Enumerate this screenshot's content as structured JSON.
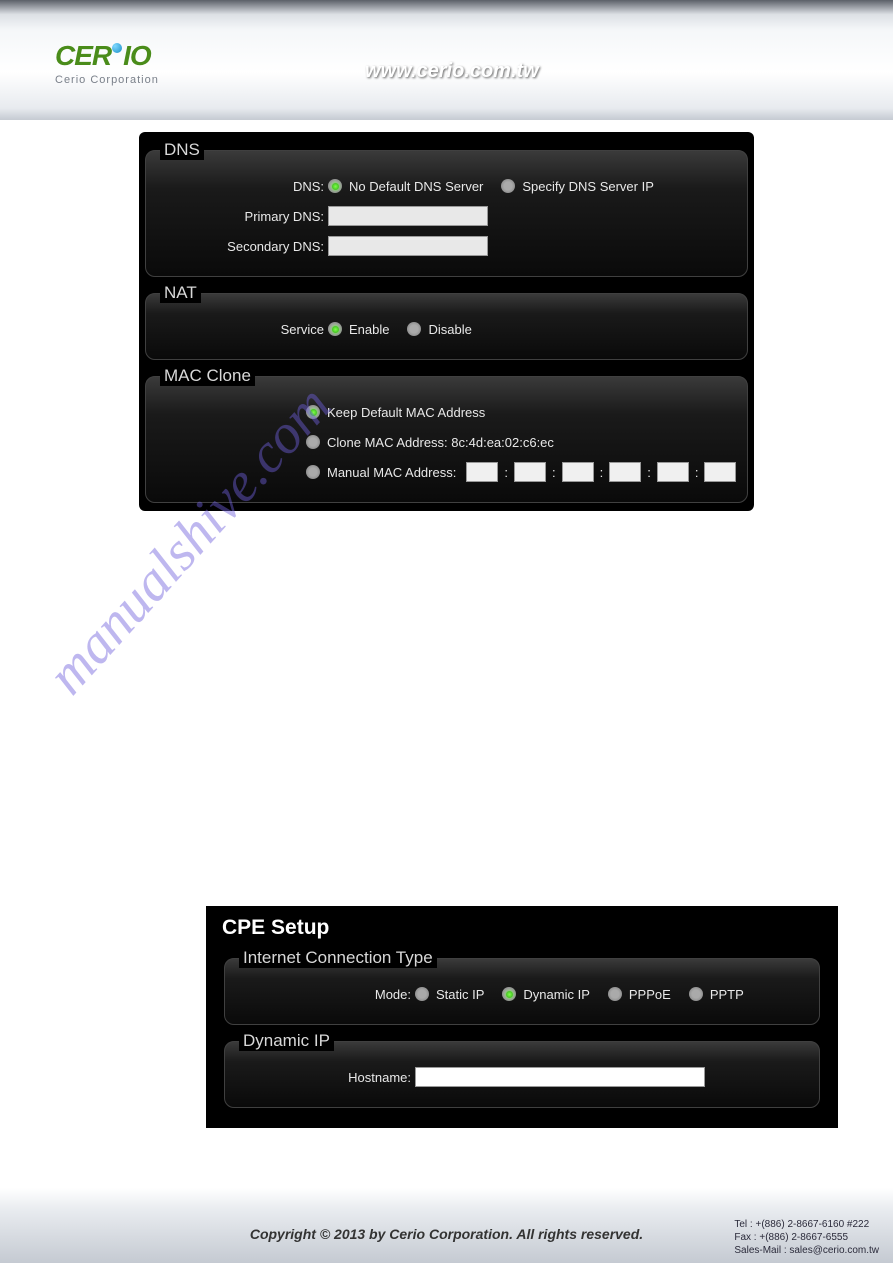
{
  "header": {
    "logo_main": "CERIO",
    "logo_sub": "Cerio Corporation",
    "url": "www.cerio.com.tw"
  },
  "dns": {
    "legend": "DNS",
    "dns_label": "DNS:",
    "radio_no_default": "No Default DNS Server",
    "radio_specify": "Specify DNS Server IP",
    "primary_label": "Primary DNS:",
    "secondary_label": "Secondary DNS:",
    "primary_value": "",
    "secondary_value": ""
  },
  "nat": {
    "legend": "NAT",
    "service_label": "Service",
    "radio_enable": "Enable",
    "radio_disable": "Disable"
  },
  "mac_clone": {
    "legend": "MAC Clone",
    "radio_keep": "Keep Default MAC Address",
    "radio_clone_prefix": "Clone MAC Address: ",
    "clone_mac_value": "8c:4d:ea:02:c6:ec",
    "radio_manual": "Manual MAC Address:",
    "mac_parts": [
      "",
      "",
      "",
      "",
      "",
      ""
    ]
  },
  "cpe": {
    "title": "CPE Setup",
    "connection": {
      "legend": "Internet Connection Type",
      "mode_label": "Mode:",
      "radio_static": "Static IP",
      "radio_dynamic": "Dynamic IP",
      "radio_pppoe": "PPPoE",
      "radio_pptp": "PPTP"
    },
    "dynamic_ip": {
      "legend": "Dynamic IP",
      "hostname_label": "Hostname:",
      "hostname_value": ""
    }
  },
  "watermark": "manualshive.com",
  "footer": {
    "copyright": "Copyright © 2013 by Cerio Corporation. All rights reserved.",
    "tel": "Tel : +(886) 2-8667-6160 #222",
    "fax": "Fax : +(886) 2-8667-6555",
    "sales": "Sales-Mail : sales@cerio.com.tw"
  }
}
